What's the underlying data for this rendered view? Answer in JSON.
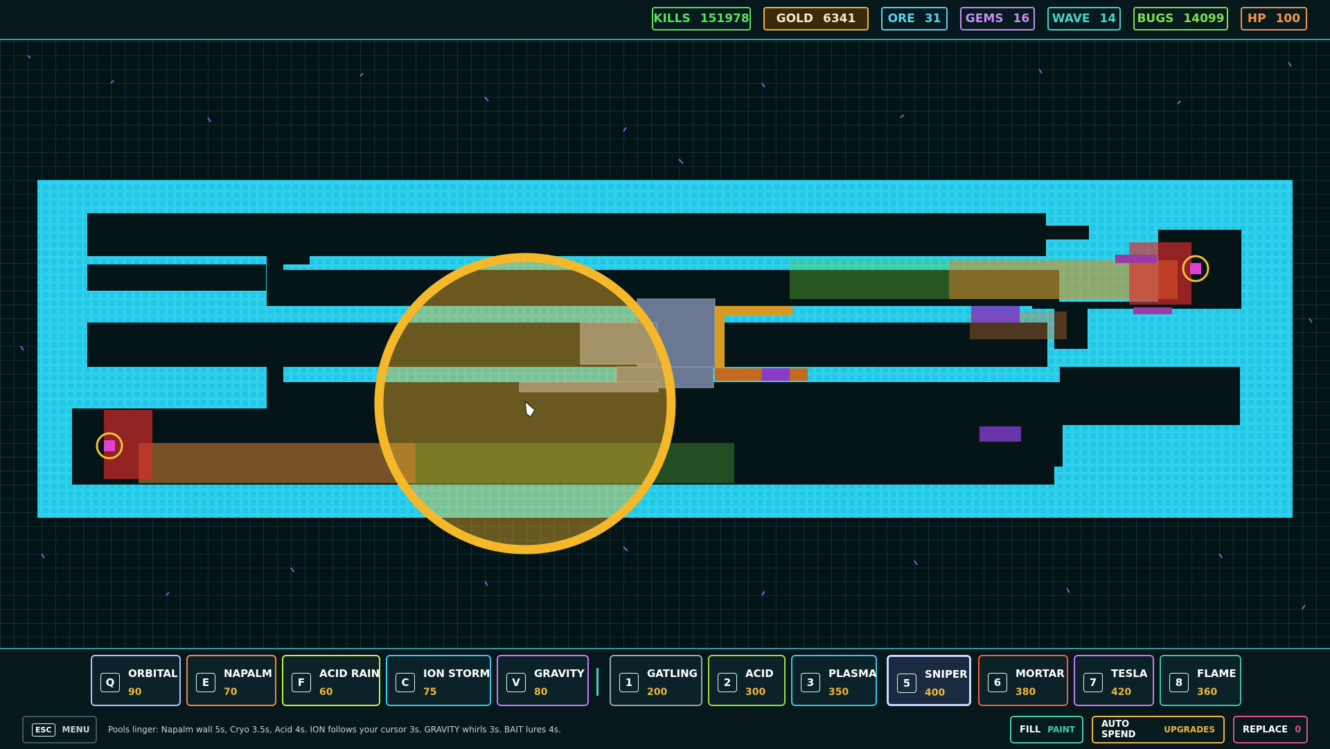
{
  "stats": [
    {
      "label": "KILLS",
      "value": "151978",
      "color": "#59e05a"
    },
    {
      "label": "GOLD",
      "value": "6341",
      "color": "#f0b63c"
    },
    {
      "label": "ORE",
      "value": "31",
      "color": "#5ad0f0"
    },
    {
      "label": "GEMS",
      "value": "16",
      "color": "#c78cf5"
    },
    {
      "label": "WAVE",
      "value": "14",
      "color": "#43d6c8"
    },
    {
      "label": "BUGS",
      "value": "14099",
      "color": "#7fe04a"
    },
    {
      "label": "HP",
      "value": "100",
      "color": "#f5944a"
    }
  ],
  "abilities": [
    {
      "key": "Q",
      "name": "ORBITAL",
      "cost": "90",
      "color": "#b8c2ff"
    },
    {
      "key": "E",
      "name": "NAPALM",
      "cost": "70",
      "color": "#f08a3a"
    },
    {
      "key": "F",
      "name": "ACID RAIN",
      "cost": "60",
      "color": "#c8f040"
    },
    {
      "key": "C",
      "name": "ION STORM",
      "cost": "75",
      "color": "#3ac8f0"
    },
    {
      "key": "V",
      "name": "GRAVITY",
      "cost": "80",
      "color": "#c87af5"
    }
  ],
  "towers": [
    {
      "key": "1",
      "name": "GATLING",
      "cost": "200",
      "color": "#9aaab0"
    },
    {
      "key": "2",
      "name": "ACID",
      "cost": "300",
      "color": "#9ae040"
    },
    {
      "key": "3",
      "name": "PLASMA",
      "cost": "350",
      "color": "#3ac8e8"
    },
    {
      "key": "5",
      "name": "SNIPER",
      "cost": "400",
      "color": "#c8d8ff"
    },
    {
      "key": "6",
      "name": "MORTAR",
      "cost": "380",
      "color": "#f06040"
    },
    {
      "key": "7",
      "name": "TESLA",
      "cost": "420",
      "color": "#c87af5"
    },
    {
      "key": "8",
      "name": "FLAME",
      "cost": "360",
      "color": "#f09a3a"
    }
  ],
  "menu": {
    "key": "ESC",
    "label": "MENU"
  },
  "hint": "Pools linger: Napalm wall 5s, Cryo 3.5s, Acid 4s. ION follows your cursor 3s. GRAVITY whirls 3s. BAIT lures 4s.",
  "controls": {
    "fill_label": "FILL",
    "fill_value": "PAINT",
    "auto_label": "AUTO SPEND",
    "auto_value": "UPGRADES",
    "replace_label": "REPLACE",
    "replace_value": "0"
  },
  "colors": {
    "wall": "#1ec8e6",
    "grid": "#1d4a4e",
    "target": "#f5b82a"
  }
}
